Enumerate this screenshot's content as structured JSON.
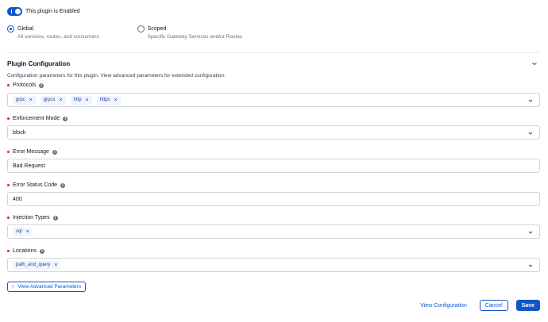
{
  "enable_toggle": {
    "label": "This plugin is Enabled",
    "on": true
  },
  "scope": {
    "options": [
      {
        "title": "Global",
        "desc": "All services, routes, and consumers",
        "checked": true
      },
      {
        "title": "Scoped",
        "desc": "Specific Gateway Services and/or Routes",
        "checked": false
      }
    ]
  },
  "config": {
    "title": "Plugin Configuration",
    "description": "Configuration parameters for this plugin. View advanced parameters for extended configuration.",
    "fields": {
      "protocols": {
        "label": "Protocols",
        "chips": [
          "grpc",
          "grpcs",
          "http",
          "https"
        ]
      },
      "enforcement_mode": {
        "label": "Enforcement Mode",
        "value": "block"
      },
      "error_message": {
        "label": "Error Message",
        "value": "Bad Request"
      },
      "error_status_code": {
        "label": "Error Status Code",
        "value": "400"
      },
      "injection_types": {
        "label": "Injection Types",
        "chips": [
          "sql"
        ]
      },
      "locations": {
        "label": "Locations",
        "chips": [
          "path_and_query"
        ]
      }
    },
    "advanced_button": "View Advanced Parameters"
  },
  "footer": {
    "view_config": "View Configuration",
    "cancel": "Cancel",
    "save": "Save"
  },
  "colors": {
    "accent": "#1155cb",
    "required": "#dc2626",
    "chip_bg": "#eff4ff"
  }
}
